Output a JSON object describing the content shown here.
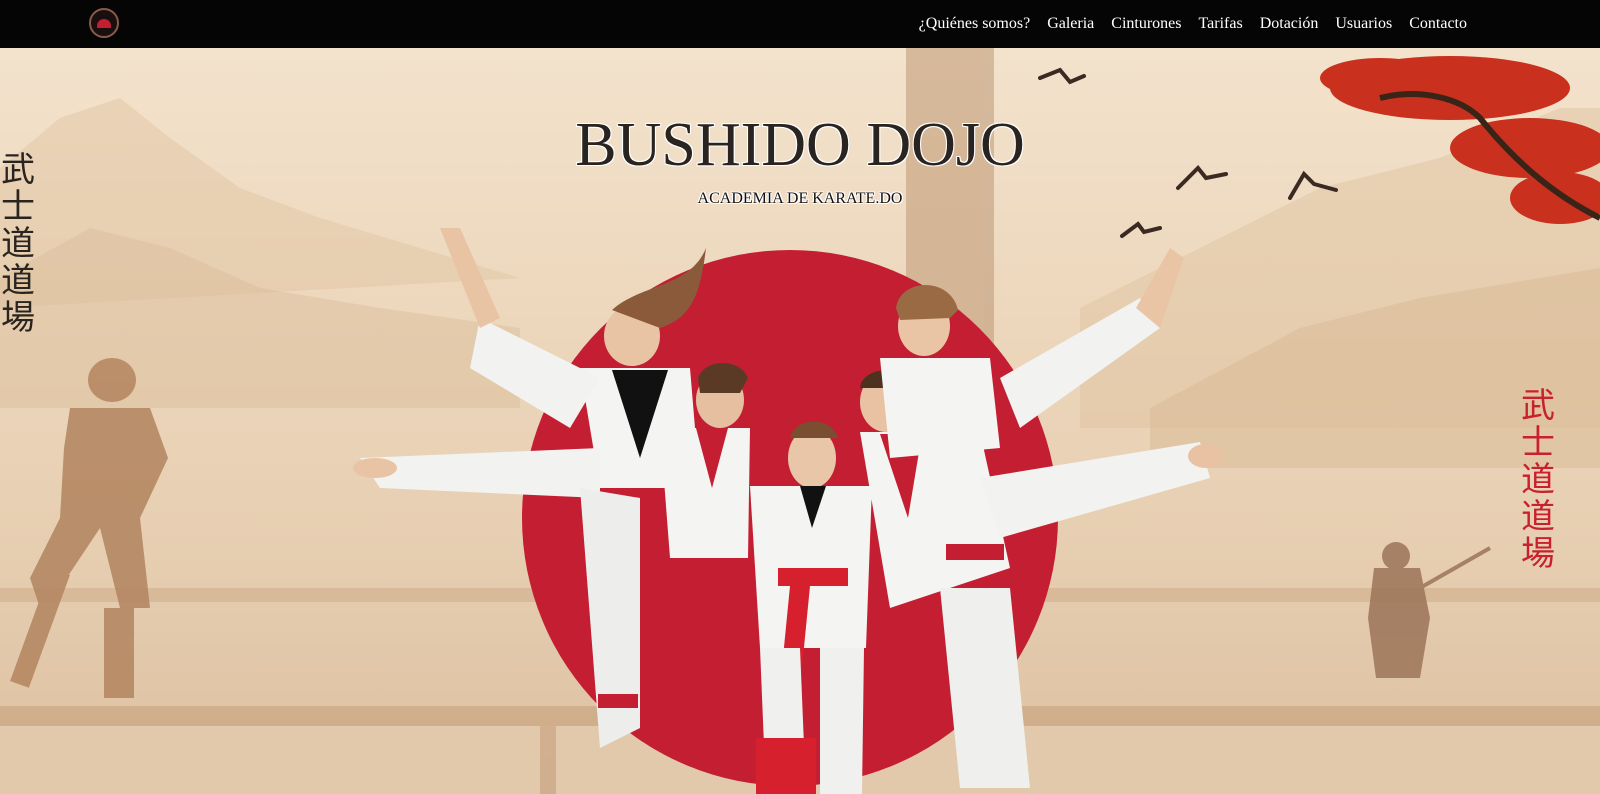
{
  "navbar": {
    "logo_icon": "dojo-logo-icon",
    "links": [
      {
        "label": "¿Quiénes somos?"
      },
      {
        "label": "Galeria"
      },
      {
        "label": "Cinturones"
      },
      {
        "label": "Tarifas"
      },
      {
        "label": "Dotación"
      },
      {
        "label": "Usuarios"
      },
      {
        "label": "Contacto"
      }
    ]
  },
  "hero": {
    "title": "BUSHIDO DOJO",
    "subtitle": "ACADEMIA DE KARATE.DO",
    "kanji_left": [
      "武",
      "士",
      "道",
      "道",
      "場"
    ],
    "kanji_right": [
      "武",
      "士",
      "道",
      "道",
      "場"
    ],
    "image": "karate-kids-kicking-image"
  },
  "colors": {
    "navbar_bg": "#050505",
    "nav_text": "#ffffff",
    "sun_red": "#c41e32",
    "kanji_accent": "#c8202c"
  }
}
